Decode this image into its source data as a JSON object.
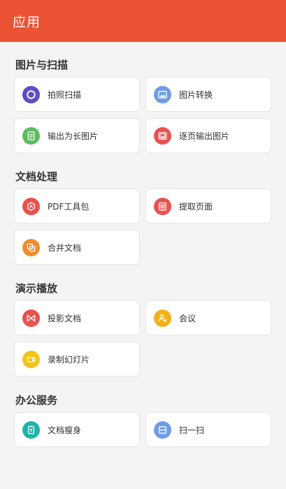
{
  "header": {
    "title": "应用"
  },
  "sections": [
    {
      "title": "图片与扫描",
      "items": [
        {
          "label": "拍照扫描",
          "icon": "camera-scan-icon",
          "color": "#5a4fc4"
        },
        {
          "label": "图片转换",
          "icon": "image-convert-icon",
          "color": "#6f9ce8"
        },
        {
          "label": "输出为长图片",
          "icon": "long-image-icon",
          "color": "#5bbd5b"
        },
        {
          "label": "逐页输出图片",
          "icon": "page-image-icon",
          "color": "#e8524f"
        }
      ]
    },
    {
      "title": "文档处理",
      "items": [
        {
          "label": "PDF工具包",
          "icon": "pdf-toolkit-icon",
          "color": "#e8524f"
        },
        {
          "label": "提取页面",
          "icon": "extract-page-icon",
          "color": "#e8524f"
        },
        {
          "label": "合并文档",
          "icon": "merge-doc-icon",
          "color": "#f08c2c"
        }
      ]
    },
    {
      "title": "演示播放",
      "items": [
        {
          "label": "投影文档",
          "icon": "projection-icon",
          "color": "#e8524f"
        },
        {
          "label": "会议",
          "icon": "meeting-icon",
          "color": "#f2b11b"
        },
        {
          "label": "录制幻灯片",
          "icon": "record-slides-icon",
          "color": "#f2c41b"
        }
      ]
    },
    {
      "title": "办公服务",
      "items": [
        {
          "label": "文档瘦身",
          "icon": "doc-slim-icon",
          "color": "#1fb3a8"
        },
        {
          "label": "扫一扫",
          "icon": "scan-icon",
          "color": "#6f9ce8"
        }
      ]
    }
  ]
}
